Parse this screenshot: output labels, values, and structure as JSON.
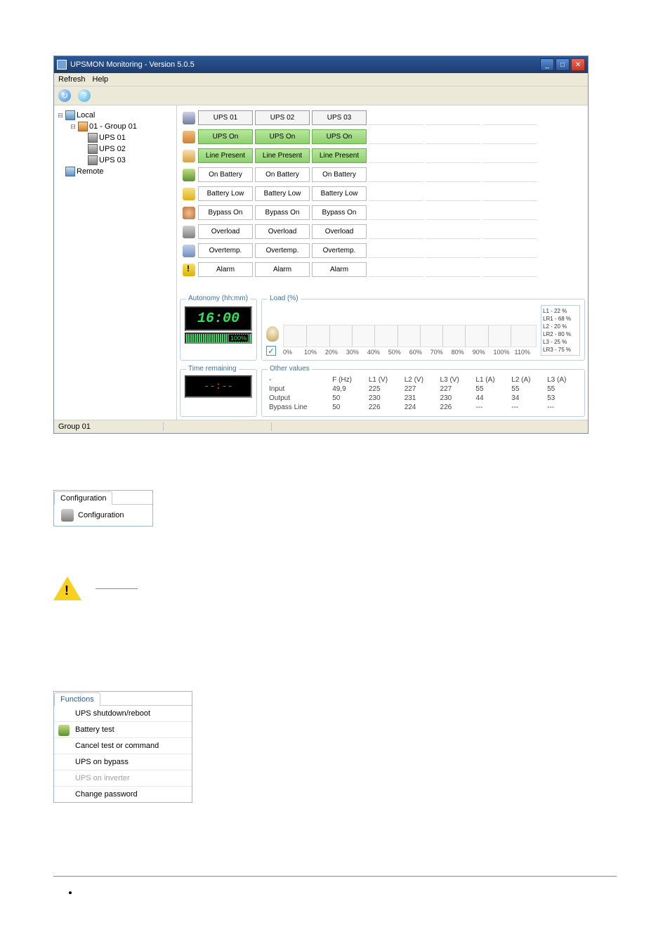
{
  "window": {
    "title": "UPSMON Monitoring - Version 5.0.5"
  },
  "menubar": {
    "refresh": "Refresh",
    "help": "Help"
  },
  "tree": {
    "local": "Local",
    "group": "01 - Group 01",
    "ups1": "UPS 01",
    "ups2": "UPS 02",
    "ups3": "UPS 03",
    "remote": "Remote"
  },
  "status_headers": {
    "c1": "UPS 01",
    "c2": "UPS 02",
    "c3": "UPS 03"
  },
  "status_rows": {
    "upson": {
      "c1": "UPS On",
      "c2": "UPS On",
      "c3": "UPS On"
    },
    "line": {
      "c1": "Line Present",
      "c2": "Line Present",
      "c3": "Line Present"
    },
    "onbatt": {
      "c1": "On Battery",
      "c2": "On Battery",
      "c3": "On Battery"
    },
    "battlow": {
      "c1": "Battery Low",
      "c2": "Battery Low",
      "c3": "Battery Low"
    },
    "bypass": {
      "c1": "Bypass On",
      "c2": "Bypass On",
      "c3": "Bypass On"
    },
    "overload": {
      "c1": "Overload",
      "c2": "Overload",
      "c3": "Overload"
    },
    "overtemp": {
      "c1": "Overtemp.",
      "c2": "Overtemp.",
      "c3": "Overtemp."
    },
    "alarm": {
      "c1": "Alarm",
      "c2": "Alarm",
      "c3": "Alarm"
    }
  },
  "autonomy": {
    "legend": "Autonomy (hh:mm)",
    "value": "16:00",
    "percent": "100%"
  },
  "load": {
    "legend": "Load (%)",
    "ticks": {
      "t0": "0%",
      "t1": "10%",
      "t2": "20%",
      "t3": "30%",
      "t4": "40%",
      "t5": "50%",
      "t6": "60%",
      "t7": "70%",
      "t8": "80%",
      "t9": "90%",
      "t10": "100%",
      "t11": "110%"
    },
    "legend_lines": {
      "l1": "L1 - 22 %",
      "lr1": "LR1 - 68 %",
      "l2": "L2 - 20 %",
      "lr2": "LR2 - 80 %",
      "l3": "L3 - 25 %",
      "lr3": "LR3 - 75 %"
    }
  },
  "time_remaining": {
    "legend": "Time remaining",
    "value": "--:--"
  },
  "other_values": {
    "legend": "Other values",
    "headers": {
      "blank": "-",
      "fhz": "F (Hz)",
      "l1v": "L1 (V)",
      "l2v": "L2 (V)",
      "l3v": "L3 (V)",
      "l1a": "L1 (A)",
      "l2a": "L2 (A)",
      "l3a": "L3 (A)"
    },
    "rows": {
      "input": {
        "label": "Input",
        "fhz": "49,9",
        "l1v": "225",
        "l2v": "227",
        "l3v": "227",
        "l1a": "55",
        "l2a": "55",
        "l3a": "55"
      },
      "output": {
        "label": "Output",
        "fhz": "50",
        "l1v": "230",
        "l2v": "231",
        "l3v": "230",
        "l1a": "44",
        "l2a": "34",
        "l3a": "53"
      },
      "bypass": {
        "label": "Bypass Line",
        "fhz": "50",
        "l1v": "226",
        "l2v": "224",
        "l3v": "226",
        "l1a": "---",
        "l2a": "---",
        "l3a": "---"
      }
    }
  },
  "statusbar": {
    "group": "Group 01"
  },
  "config_snip": {
    "tab": "Configuration",
    "item": "Configuration"
  },
  "functions_snip": {
    "tab": "Functions",
    "items": {
      "shutdown": "UPS shutdown/reboot",
      "battery_test": "Battery test",
      "cancel": "Cancel test or command",
      "bypass": "UPS on bypass",
      "inverter": "UPS on inverter",
      "password": "Change password"
    }
  }
}
